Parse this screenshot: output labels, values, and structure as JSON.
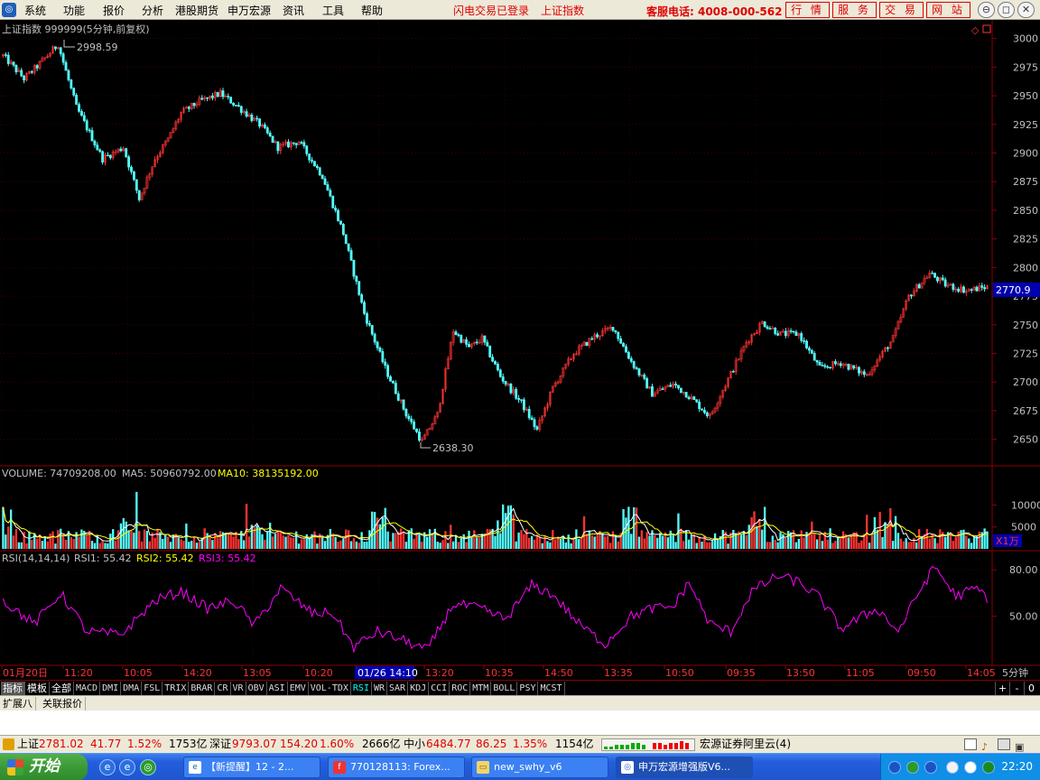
{
  "menu": {
    "logo": "◎",
    "items": [
      "系统",
      "功能",
      "报价",
      "分析",
      "港股期货",
      "申万宏源",
      "资讯",
      "工具",
      "帮助"
    ],
    "status_login": "闪电交易已登录",
    "status_index": "上证指数",
    "hotline": "客服电话: 4008-000-562",
    "top_buttons": [
      "行 情",
      "服 务",
      "交 易",
      "网 站"
    ],
    "window_controls": [
      "⊖",
      "◻",
      "✕"
    ]
  },
  "chart_data": [
    {
      "type": "candlestick",
      "title": "上证指数 999999(5分钟,前复权)",
      "ylim": [
        2630,
        3010
      ],
      "yticks": [
        3000,
        2975,
        2950,
        2925,
        2900,
        2875,
        2850,
        2825,
        2800,
        2775,
        2750,
        2725,
        2700,
        2675,
        2650
      ],
      "last_price_label": "2770.9",
      "annotations": [
        {
          "text": "2998.59",
          "kind": "high"
        },
        {
          "text": "2638.30",
          "kind": "low"
        }
      ],
      "anchors": [
        [
          0,
          2985
        ],
        [
          8,
          2965
        ],
        [
          14,
          2978
        ],
        [
          21,
          2995
        ],
        [
          28,
          2940
        ],
        [
          38,
          2895
        ],
        [
          46,
          2905
        ],
        [
          52,
          2860
        ],
        [
          58,
          2895
        ],
        [
          63,
          2912
        ],
        [
          68,
          2935
        ],
        [
          75,
          2945
        ],
        [
          83,
          2952
        ],
        [
          90,
          2940
        ],
        [
          98,
          2925
        ],
        [
          105,
          2905
        ],
        [
          113,
          2910
        ],
        [
          122,
          2880
        ],
        [
          130,
          2830
        ],
        [
          138,
          2760
        ],
        [
          146,
          2712
        ],
        [
          154,
          2672
        ],
        [
          160,
          2648
        ],
        [
          166,
          2672
        ],
        [
          172,
          2745
        ],
        [
          178,
          2730
        ],
        [
          183,
          2738
        ],
        [
          190,
          2705
        ],
        [
          198,
          2682
        ],
        [
          204,
          2658
        ],
        [
          210,
          2695
        ],
        [
          218,
          2725
        ],
        [
          226,
          2740
        ],
        [
          233,
          2748
        ],
        [
          240,
          2718
        ],
        [
          248,
          2690
        ],
        [
          256,
          2698
        ],
        [
          262,
          2688
        ],
        [
          270,
          2670
        ],
        [
          276,
          2698
        ],
        [
          284,
          2735
        ],
        [
          290,
          2752
        ],
        [
          297,
          2742
        ],
        [
          304,
          2742
        ],
        [
          312,
          2712
        ],
        [
          320,
          2717
        ],
        [
          330,
          2706
        ],
        [
          340,
          2738
        ],
        [
          346,
          2775
        ],
        [
          354,
          2795
        ],
        [
          360,
          2785
        ],
        [
          368,
          2780
        ],
        [
          376,
          2783
        ]
      ],
      "n_bars": 377
    },
    {
      "type": "volume",
      "series_label": "VOLUME: 74709208.00",
      "ma5_label": "MA5: 50960792.00",
      "ma10_label": "MA10: 38135192.00",
      "yticks": [
        10000,
        5000
      ],
      "unit": "X1万",
      "ylim": [
        0,
        14000
      ]
    },
    {
      "type": "line",
      "series_label": "RSI(14,14,14)",
      "rsi1_label": "RSI1: 55.42",
      "rsi2_label": "RSI2: 55.42",
      "rsi3_label": "RSI3: 55.42",
      "yticks": [
        80.0,
        50.0
      ],
      "ylim": [
        20,
        90
      ],
      "anchors": [
        [
          0,
          60
        ],
        [
          12,
          45
        ],
        [
          22,
          65
        ],
        [
          32,
          40
        ],
        [
          45,
          38
        ],
        [
          58,
          60
        ],
        [
          68,
          66
        ],
        [
          78,
          55
        ],
        [
          88,
          60
        ],
        [
          96,
          44
        ],
        [
          106,
          68
        ],
        [
          118,
          52
        ],
        [
          126,
          52
        ],
        [
          134,
          30
        ],
        [
          143,
          40
        ],
        [
          152,
          35
        ],
        [
          162,
          28
        ],
        [
          172,
          58
        ],
        [
          182,
          55
        ],
        [
          192,
          48
        ],
        [
          202,
          70
        ],
        [
          210,
          64
        ],
        [
          220,
          45
        ],
        [
          230,
          32
        ],
        [
          240,
          50
        ],
        [
          248,
          55
        ],
        [
          256,
          56
        ],
        [
          262,
          72
        ],
        [
          270,
          45
        ],
        [
          278,
          40
        ],
        [
          286,
          66
        ],
        [
          296,
          76
        ],
        [
          304,
          72
        ],
        [
          312,
          62
        ],
        [
          320,
          42
        ],
        [
          334,
          55
        ],
        [
          342,
          40
        ],
        [
          350,
          66
        ],
        [
          356,
          82
        ],
        [
          364,
          63
        ],
        [
          372,
          68
        ],
        [
          376,
          62
        ]
      ]
    }
  ],
  "time_axis": [
    "01月20日",
    "11:20",
    "10:05",
    "14:20",
    "13:05",
    "10:20",
    "01/26 14:10",
    "13:20",
    "10:35",
    "14:50",
    "13:35",
    "10:50",
    "09:35",
    "13:50",
    "11:05",
    "09:50",
    "14:05"
  ],
  "period_label": "5分钟",
  "indicator_tabs": [
    "指标",
    "模板",
    "全部",
    "MACD",
    "DMI",
    "DMA",
    "FSL",
    "TRIX",
    "BRAR",
    "CR",
    "VR",
    "OBV",
    "ASI",
    "EMV",
    "VOL-TDX",
    "RSI",
    "WR",
    "SAR",
    "KDJ",
    "CCI",
    "ROC",
    "MTM",
    "BOLL",
    "PSY",
    "MCST"
  ],
  "active_tab": "RSI",
  "tab_nav": [
    "+",
    "-",
    "0"
  ],
  "ext_tabs": [
    "扩展八",
    "关联报价"
  ],
  "ticker": {
    "sh_label": "上证",
    "sh_price": "2781.02",
    "sh_chg": "41.77",
    "sh_pct": "1.52%",
    "sh_amt": "1753亿",
    "sz_label": "深证",
    "sz_price": "9793.07",
    "sz_chg": "154.20",
    "sz_pct": "1.60%",
    "sz_amt": "2666亿",
    "zx_label": "中小",
    "zx_price": "6484.77",
    "zx_chg": "86.25",
    "zx_pct": "1.35%",
    "zx_amt": "1154亿",
    "server": "宏源证券阿里云(4)"
  },
  "taskbar": {
    "start": "开始",
    "buttons": [
      "【新提醒】12 - 2...",
      "770128113: Forex...",
      "new_swhy_v6",
      "申万宏源增强版V6..."
    ],
    "clock": "22:20"
  },
  "colors": {
    "up": "#ff3333",
    "down": "#54ffff",
    "frame": "#8b0000",
    "ma5": "#ffffff",
    "ma10": "#ffff00",
    "rsi": "#ff00ff",
    "axis_text": "#c0c0c0"
  }
}
